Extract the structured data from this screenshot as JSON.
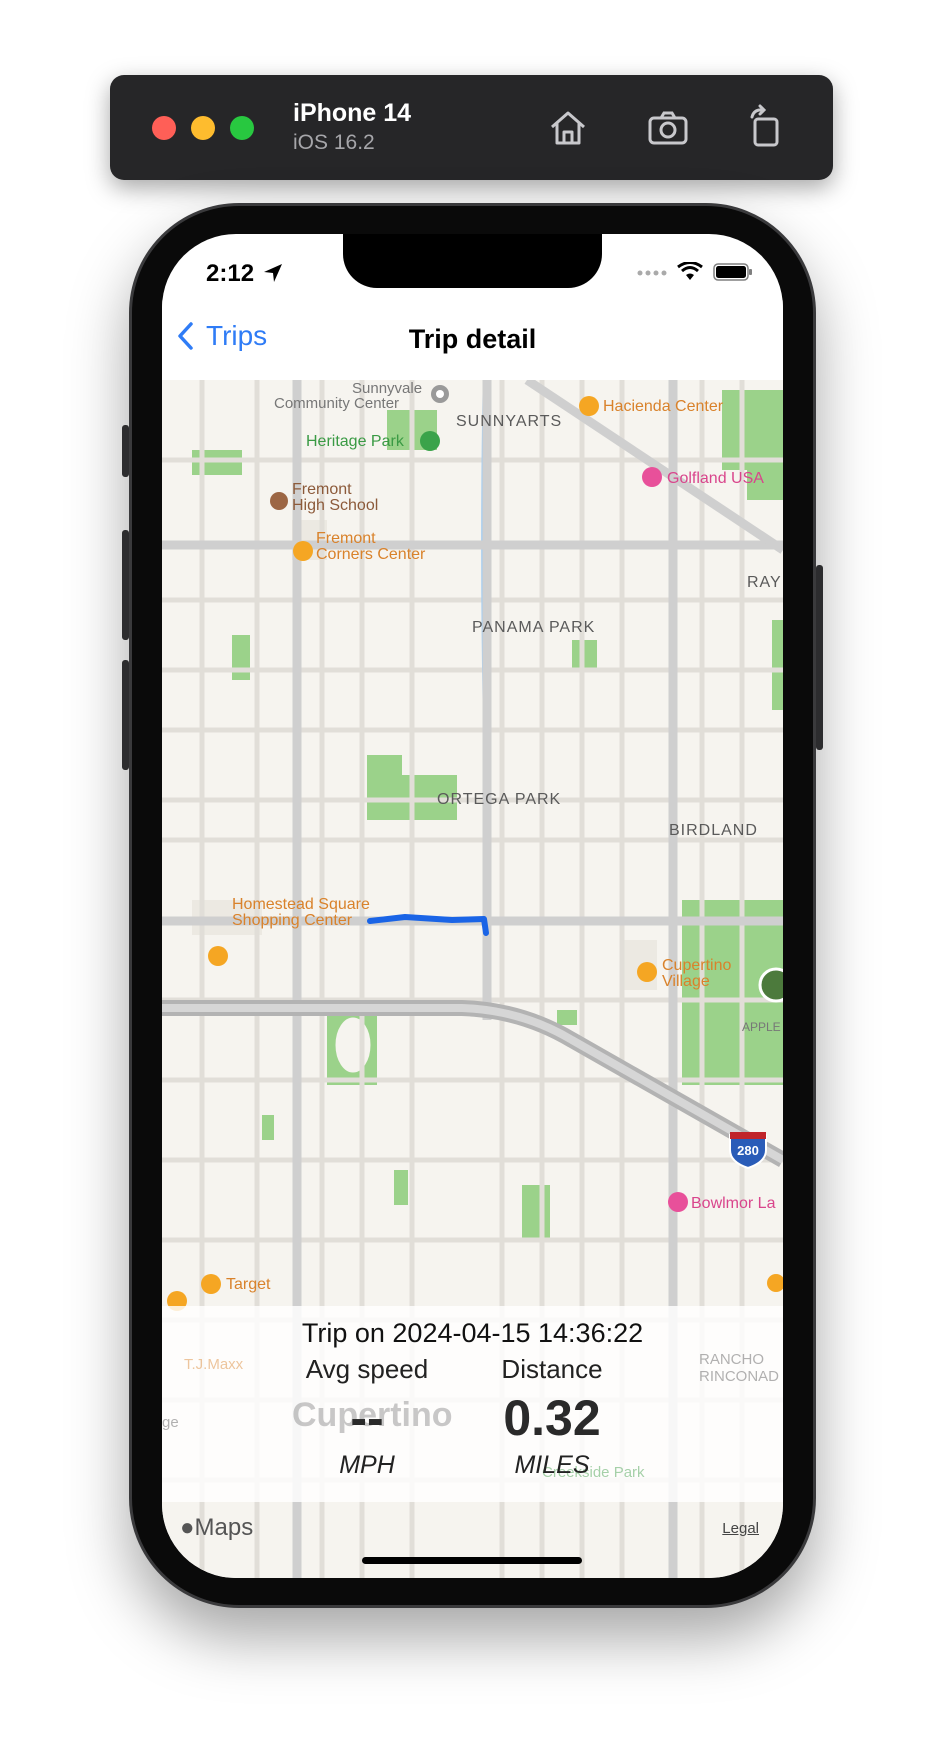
{
  "simulator": {
    "device_name": "iPhone 14",
    "os_version": "iOS 16.2",
    "icons": [
      "home-icon",
      "screenshot-icon",
      "rotate-icon"
    ]
  },
  "status_bar": {
    "time": "2:12"
  },
  "nav": {
    "back_label": "Trips",
    "title": "Trip detail"
  },
  "map": {
    "labels": {
      "sunnyvale_cc": "Sunnyvale\nCommunity Center",
      "sunnyarts": "SUNNYARTS",
      "hacienda": "Hacienda Center",
      "heritage": "Heritage Park",
      "golfland": "Golfland USA",
      "fremont_hs": "Fremont\nHigh School",
      "fremont_cc": "Fremont\nCorners Center",
      "rayn": "RAYN",
      "panama": "PANAMA PARK",
      "ortega": "ORTEGA PARK",
      "birdland": "BIRDLAND",
      "homestead": "Homestead Square\nShopping Center",
      "cupertino_village": "Cupertino\nVillage",
      "apple": "APPLE",
      "i280": "280",
      "bowlmor": "Bowlmor La",
      "target": "Target",
      "tjmaxx": "T.J.Maxx",
      "cupertino": "Cupertino",
      "rancho": "RANCHO\nRINCONAD",
      "creekside": "Creekside Park",
      "ge": "ge"
    }
  },
  "trip": {
    "title": "Trip on 2024-04-15 14:36:22",
    "avg_speed_label": "Avg speed",
    "avg_speed_value": "--",
    "avg_speed_unit": "MPH",
    "distance_label": "Distance",
    "distance_value": "0.32",
    "distance_unit": "MILES"
  },
  "footer": {
    "maps_brand": "Maps",
    "legal": "Legal"
  },
  "colors": {
    "accent": "#2f7cf6",
    "route": "#1a64e6",
    "map_bg": "#f6f4ef",
    "park": "#9bd28a",
    "poi_orange": "#e08a2a"
  }
}
